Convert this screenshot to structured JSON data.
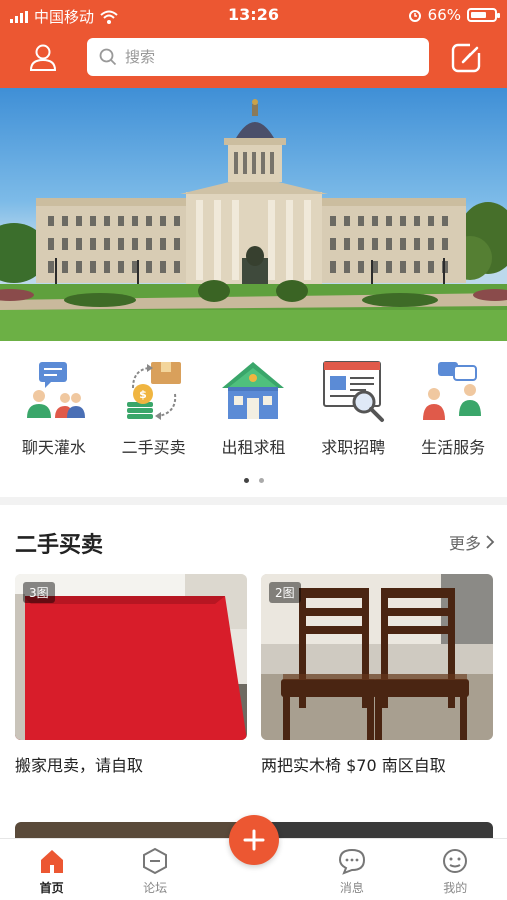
{
  "status_bar": {
    "carrier": "中国移动",
    "time": "13:26",
    "battery": "66%",
    "battery_level": 0.66
  },
  "header": {
    "search_placeholder": "搜索",
    "user_icon": "user-icon",
    "edit_icon": "edit-icon"
  },
  "banner": {
    "subject": "legislative-building-photo"
  },
  "categories": [
    {
      "label": "聊天灌水",
      "icon": "chat-people-icon"
    },
    {
      "label": "二手买卖",
      "icon": "secondhand-exchange-icon"
    },
    {
      "label": "出租求租",
      "icon": "house-icon"
    },
    {
      "label": "求职招聘",
      "icon": "job-document-icon"
    },
    {
      "label": "生活服务",
      "icon": "service-people-icon"
    }
  ],
  "section": {
    "title": "二手买卖",
    "more_label": "更多"
  },
  "listings": [
    {
      "badge": "3图",
      "title": "搬家甩卖，请自取"
    },
    {
      "badge": "2图",
      "title": "两把实木椅 $70 南区自取"
    }
  ],
  "tabs": [
    {
      "label": "首页",
      "icon": "home-icon",
      "active": true
    },
    {
      "label": "论坛",
      "icon": "forum-icon",
      "active": false
    },
    {
      "label": "消息",
      "icon": "message-icon",
      "active": false
    },
    {
      "label": "我的",
      "icon": "profile-icon",
      "active": false
    }
  ],
  "colors": {
    "brand": "#ec5732",
    "text": "#222222",
    "muted": "#888888"
  }
}
